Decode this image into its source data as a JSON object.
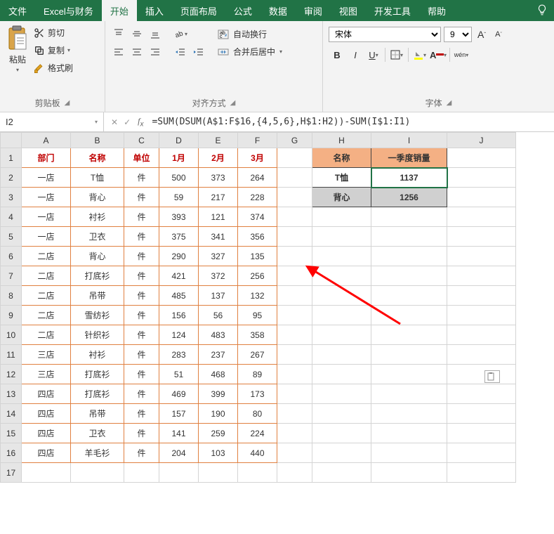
{
  "tabs": [
    "文件",
    "Excel与财务",
    "开始",
    "插入",
    "页面布局",
    "公式",
    "数据",
    "审阅",
    "视图",
    "开发工具",
    "帮助"
  ],
  "active_tab_index": 2,
  "ribbon": {
    "clipboard": {
      "paste": "粘贴",
      "cut": "剪切",
      "copy": "复制",
      "format_painter": "格式刷",
      "group_label": "剪贴板"
    },
    "alignment": {
      "wrap_text": "自动换行",
      "merge_center": "合并后居中",
      "group_label": "对齐方式"
    },
    "font": {
      "name": "宋体",
      "size": "9",
      "increase": "A",
      "decrease": "A",
      "group_label": "字体",
      "wen": "wén"
    }
  },
  "namebox": "I2",
  "formula": "=SUM(DSUM(A$1:F$16,{4,5,6},H$1:H2))-SUM(I$1:I1)",
  "columns": [
    "",
    "A",
    "B",
    "C",
    "D",
    "E",
    "F",
    "G",
    "H",
    "I",
    "J"
  ],
  "main_headers": [
    "部门",
    "名称",
    "单位",
    "1月",
    "2月",
    "3月"
  ],
  "summary_headers": [
    "名称",
    "一季度销量"
  ],
  "main_rows": [
    [
      "1",
      "一店",
      "T恤",
      "件",
      "500",
      "373",
      "264"
    ],
    [
      "2",
      "一店",
      "背心",
      "件",
      "59",
      "217",
      "228"
    ],
    [
      "3",
      "一店",
      "衬衫",
      "件",
      "393",
      "121",
      "374"
    ],
    [
      "4",
      "一店",
      "卫衣",
      "件",
      "375",
      "341",
      "356"
    ],
    [
      "5",
      "二店",
      "背心",
      "件",
      "290",
      "327",
      "135"
    ],
    [
      "6",
      "二店",
      "打底衫",
      "件",
      "421",
      "372",
      "256"
    ],
    [
      "7",
      "二店",
      "吊带",
      "件",
      "485",
      "137",
      "132"
    ],
    [
      "8",
      "二店",
      "雪纺衫",
      "件",
      "156",
      "56",
      "95"
    ],
    [
      "9",
      "二店",
      "针织衫",
      "件",
      "124",
      "483",
      "358"
    ],
    [
      "10",
      "三店",
      "衬衫",
      "件",
      "283",
      "237",
      "267"
    ],
    [
      "11",
      "三店",
      "打底衫",
      "件",
      "51",
      "468",
      "89"
    ],
    [
      "12",
      "四店",
      "打底衫",
      "件",
      "469",
      "399",
      "173"
    ],
    [
      "13",
      "四店",
      "吊带",
      "件",
      "157",
      "190",
      "80"
    ],
    [
      "14",
      "四店",
      "卫衣",
      "件",
      "141",
      "259",
      "224"
    ],
    [
      "15",
      "四店",
      "羊毛衫",
      "件",
      "204",
      "103",
      "440"
    ]
  ],
  "summary_rows": [
    [
      "T恤",
      "1137"
    ],
    [
      "背心",
      "1256"
    ]
  ],
  "row_numbers": [
    "1",
    "2",
    "3",
    "4",
    "5",
    "6",
    "7",
    "8",
    "9",
    "10",
    "11",
    "12",
    "13",
    "14",
    "15",
    "16",
    "17"
  ],
  "chart_data": {
    "type": "table",
    "title": "",
    "main_table": {
      "headers": [
        "部门",
        "名称",
        "单位",
        "1月",
        "2月",
        "3月"
      ],
      "rows": [
        [
          "一店",
          "T恤",
          "件",
          500,
          373,
          264
        ],
        [
          "一店",
          "背心",
          "件",
          59,
          217,
          228
        ],
        [
          "一店",
          "衬衫",
          "件",
          393,
          121,
          374
        ],
        [
          "一店",
          "卫衣",
          "件",
          375,
          341,
          356
        ],
        [
          "二店",
          "背心",
          "件",
          290,
          327,
          135
        ],
        [
          "二店",
          "打底衫",
          "件",
          421,
          372,
          256
        ],
        [
          "二店",
          "吊带",
          "件",
          485,
          137,
          132
        ],
        [
          "二店",
          "雪纺衫",
          "件",
          156,
          56,
          95
        ],
        [
          "二店",
          "针织衫",
          "件",
          124,
          483,
          358
        ],
        [
          "三店",
          "衬衫",
          "件",
          283,
          237,
          267
        ],
        [
          "三店",
          "打底衫",
          "件",
          51,
          468,
          89
        ],
        [
          "四店",
          "打底衫",
          "件",
          469,
          399,
          173
        ],
        [
          "四店",
          "吊带",
          "件",
          157,
          190,
          80
        ],
        [
          "四店",
          "卫衣",
          "件",
          141,
          259,
          224
        ],
        [
          "四店",
          "羊毛衫",
          "件",
          204,
          103,
          440
        ]
      ]
    },
    "summary_table": {
      "headers": [
        "名称",
        "一季度销量"
      ],
      "rows": [
        [
          "T恤",
          1137
        ],
        [
          "背心",
          1256
        ]
      ]
    }
  }
}
